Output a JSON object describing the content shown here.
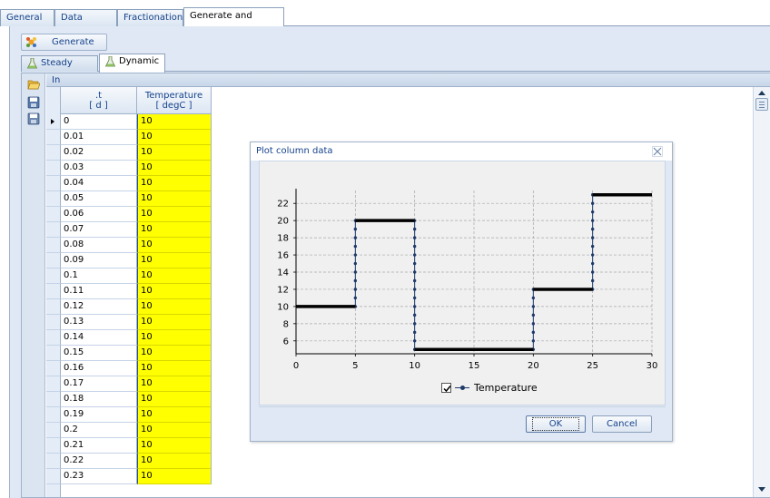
{
  "top_tabs": [
    {
      "label": "General",
      "active": false
    },
    {
      "label": "Data Import",
      "active": false
    },
    {
      "label": "Fractionation",
      "active": false
    },
    {
      "label": "Generate and Review",
      "active": true
    }
  ],
  "generate_button": {
    "label": "Generate",
    "icon": "generate-icon"
  },
  "sub_tabs": [
    {
      "label": "Steady State",
      "icon": "flask-icon",
      "active": false
    },
    {
      "label": "Dynamic",
      "icon": "flask-icon",
      "active": true
    }
  ],
  "toolbar": {
    "icons": [
      "open-folder-icon",
      "save-icon",
      "save-as-icon"
    ]
  },
  "grid": {
    "caption": "In",
    "columns": [
      {
        "name": ".t",
        "unit": "[ d ]"
      },
      {
        "name": "Temperature",
        "unit": "[ degC ]"
      }
    ],
    "rows": [
      {
        "t": "0",
        "value": "10"
      },
      {
        "t": "0.01",
        "value": "10"
      },
      {
        "t": "0.02",
        "value": "10"
      },
      {
        "t": "0.03",
        "value": "10"
      },
      {
        "t": "0.04",
        "value": "10"
      },
      {
        "t": "0.05",
        "value": "10"
      },
      {
        "t": "0.06",
        "value": "10"
      },
      {
        "t": "0.07",
        "value": "10"
      },
      {
        "t": "0.08",
        "value": "10"
      },
      {
        "t": "0.09",
        "value": "10"
      },
      {
        "t": "0.1",
        "value": "10"
      },
      {
        "t": "0.11",
        "value": "10"
      },
      {
        "t": "0.12",
        "value": "10"
      },
      {
        "t": "0.13",
        "value": "10"
      },
      {
        "t": "0.14",
        "value": "10"
      },
      {
        "t": "0.15",
        "value": "10"
      },
      {
        "t": "0.16",
        "value": "10"
      },
      {
        "t": "0.17",
        "value": "10"
      },
      {
        "t": "0.18",
        "value": "10"
      },
      {
        "t": "0.19",
        "value": "10"
      },
      {
        "t": "0.2",
        "value": "10"
      },
      {
        "t": "0.21",
        "value": "10"
      },
      {
        "t": "0.22",
        "value": "10"
      },
      {
        "t": "0.23",
        "value": "10"
      }
    ],
    "current_row": 0,
    "value_highlight_color": "#ffff00"
  },
  "dialog": {
    "title": "Plot column data",
    "close_icon": "close-icon",
    "ok_label": "OK",
    "cancel_label": "Cancel",
    "legend_label": "Temperature",
    "legend_checked": true
  },
  "chart_data": {
    "type": "line",
    "title": "",
    "xlabel": "",
    "ylabel": "",
    "xlim": [
      0,
      30
    ],
    "ylim": [
      4.5,
      23.5
    ],
    "x_ticks": [
      0,
      5,
      10,
      15,
      20,
      25,
      30
    ],
    "y_ticks": [
      6,
      8,
      10,
      12,
      14,
      16,
      18,
      20,
      22
    ],
    "grid": true,
    "legend_position": "bottom",
    "series": [
      {
        "name": "Temperature",
        "color": "#1e3a6b",
        "segments": [
          {
            "x": [
              0,
              5
            ],
            "y": [
              10,
              10
            ]
          },
          {
            "x": [
              5,
              10
            ],
            "y": [
              20,
              20
            ]
          },
          {
            "x": [
              10,
              20
            ],
            "y": [
              5,
              5
            ]
          },
          {
            "x": [
              20,
              25
            ],
            "y": [
              12,
              12
            ]
          },
          {
            "x": [
              25,
              30
            ],
            "y": [
              23,
              23
            ]
          }
        ],
        "transitions": [
          {
            "x": 5,
            "y_from": 10,
            "y_to": 20
          },
          {
            "x": 10,
            "y_from": 20,
            "y_to": 5
          },
          {
            "x": 20,
            "y_from": 5,
            "y_to": 12
          },
          {
            "x": 25,
            "y_from": 12,
            "y_to": 23
          }
        ]
      }
    ]
  }
}
